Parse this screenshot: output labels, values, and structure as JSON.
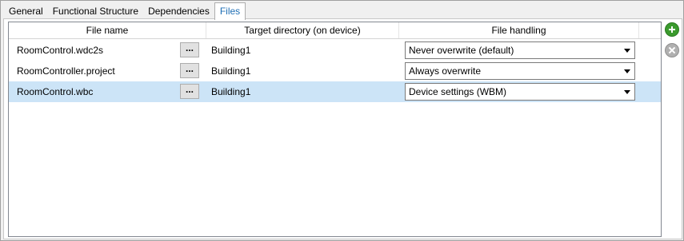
{
  "tabs": [
    {
      "label": "General"
    },
    {
      "label": "Functional Structure"
    },
    {
      "label": "Dependencies"
    },
    {
      "label": "Files",
      "active": true
    }
  ],
  "table": {
    "headers": {
      "file_name": "File name",
      "target_directory": "Target directory (on device)",
      "file_handling": "File handling"
    },
    "browse_label": "...",
    "rows": [
      {
        "file_name": "RoomControl.wdc2s",
        "target_directory": "Building1",
        "file_handling": "Never overwrite (default)",
        "selected": false
      },
      {
        "file_name": "RoomController.project",
        "target_directory": "Building1",
        "file_handling": "Always overwrite",
        "selected": false
      },
      {
        "file_name": "RoomControl.wbc",
        "target_directory": "Building1",
        "file_handling": "Device settings (WBM)",
        "selected": true
      }
    ]
  },
  "actions": {
    "add_icon": "plus-circle-icon",
    "remove_icon": "x-circle-icon",
    "add_color": "#3a9a2d",
    "remove_color": "#b0b0b0"
  },
  "colors": {
    "selected_row": "#cce4f7",
    "active_tab_text": "#1e6eb4"
  }
}
